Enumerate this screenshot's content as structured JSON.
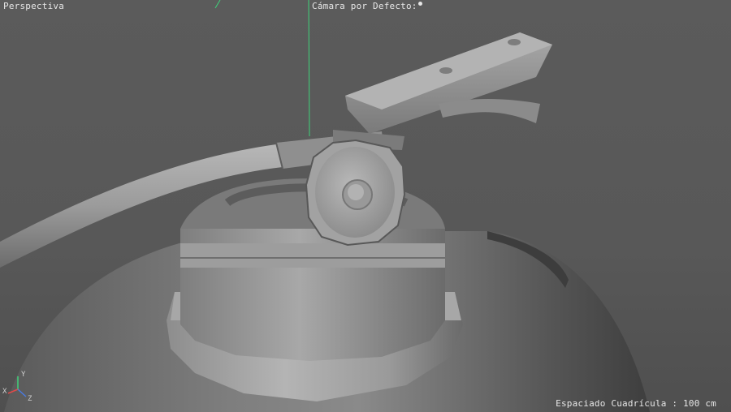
{
  "viewport": {
    "view_name": "Perspectiva",
    "camera_name": "Cámara por Defecto:",
    "grid_spacing": "Espaciado Cuadrícula : 100 cm"
  },
  "axis_gizmo": {
    "y_label": "Y",
    "x_label": "X",
    "z_label": "Z"
  },
  "colors": {
    "background": "#585858",
    "y_axis": "#3fd37a",
    "x_axis": "#e04a4a",
    "z_axis": "#4a7ae0",
    "hud_text": "#e6e6e6"
  }
}
